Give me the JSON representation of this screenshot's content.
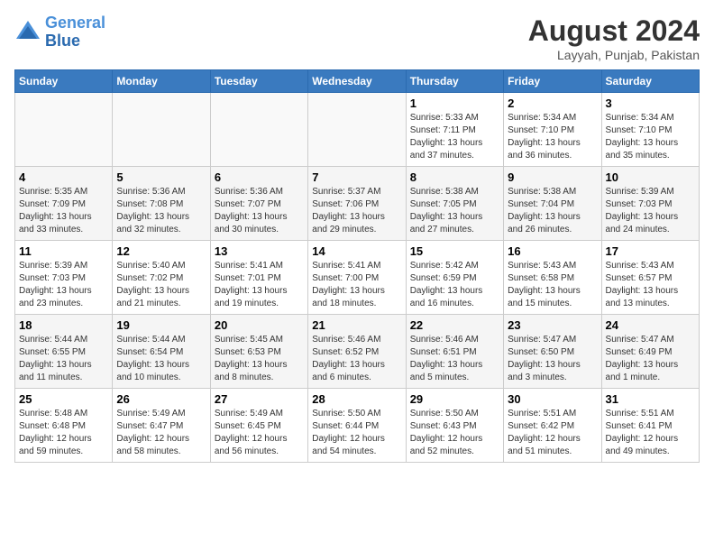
{
  "header": {
    "logo_line1": "General",
    "logo_line2": "Blue",
    "month_year": "August 2024",
    "location": "Layyah, Punjab, Pakistan"
  },
  "weekdays": [
    "Sunday",
    "Monday",
    "Tuesday",
    "Wednesday",
    "Thursday",
    "Friday",
    "Saturday"
  ],
  "weeks": [
    [
      {
        "day": "",
        "info": ""
      },
      {
        "day": "",
        "info": ""
      },
      {
        "day": "",
        "info": ""
      },
      {
        "day": "",
        "info": ""
      },
      {
        "day": "1",
        "info": "Sunrise: 5:33 AM\nSunset: 7:11 PM\nDaylight: 13 hours\nand 37 minutes."
      },
      {
        "day": "2",
        "info": "Sunrise: 5:34 AM\nSunset: 7:10 PM\nDaylight: 13 hours\nand 36 minutes."
      },
      {
        "day": "3",
        "info": "Sunrise: 5:34 AM\nSunset: 7:10 PM\nDaylight: 13 hours\nand 35 minutes."
      }
    ],
    [
      {
        "day": "4",
        "info": "Sunrise: 5:35 AM\nSunset: 7:09 PM\nDaylight: 13 hours\nand 33 minutes."
      },
      {
        "day": "5",
        "info": "Sunrise: 5:36 AM\nSunset: 7:08 PM\nDaylight: 13 hours\nand 32 minutes."
      },
      {
        "day": "6",
        "info": "Sunrise: 5:36 AM\nSunset: 7:07 PM\nDaylight: 13 hours\nand 30 minutes."
      },
      {
        "day": "7",
        "info": "Sunrise: 5:37 AM\nSunset: 7:06 PM\nDaylight: 13 hours\nand 29 minutes."
      },
      {
        "day": "8",
        "info": "Sunrise: 5:38 AM\nSunset: 7:05 PM\nDaylight: 13 hours\nand 27 minutes."
      },
      {
        "day": "9",
        "info": "Sunrise: 5:38 AM\nSunset: 7:04 PM\nDaylight: 13 hours\nand 26 minutes."
      },
      {
        "day": "10",
        "info": "Sunrise: 5:39 AM\nSunset: 7:03 PM\nDaylight: 13 hours\nand 24 minutes."
      }
    ],
    [
      {
        "day": "11",
        "info": "Sunrise: 5:39 AM\nSunset: 7:03 PM\nDaylight: 13 hours\nand 23 minutes."
      },
      {
        "day": "12",
        "info": "Sunrise: 5:40 AM\nSunset: 7:02 PM\nDaylight: 13 hours\nand 21 minutes."
      },
      {
        "day": "13",
        "info": "Sunrise: 5:41 AM\nSunset: 7:01 PM\nDaylight: 13 hours\nand 19 minutes."
      },
      {
        "day": "14",
        "info": "Sunrise: 5:41 AM\nSunset: 7:00 PM\nDaylight: 13 hours\nand 18 minutes."
      },
      {
        "day": "15",
        "info": "Sunrise: 5:42 AM\nSunset: 6:59 PM\nDaylight: 13 hours\nand 16 minutes."
      },
      {
        "day": "16",
        "info": "Sunrise: 5:43 AM\nSunset: 6:58 PM\nDaylight: 13 hours\nand 15 minutes."
      },
      {
        "day": "17",
        "info": "Sunrise: 5:43 AM\nSunset: 6:57 PM\nDaylight: 13 hours\nand 13 minutes."
      }
    ],
    [
      {
        "day": "18",
        "info": "Sunrise: 5:44 AM\nSunset: 6:55 PM\nDaylight: 13 hours\nand 11 minutes."
      },
      {
        "day": "19",
        "info": "Sunrise: 5:44 AM\nSunset: 6:54 PM\nDaylight: 13 hours\nand 10 minutes."
      },
      {
        "day": "20",
        "info": "Sunrise: 5:45 AM\nSunset: 6:53 PM\nDaylight: 13 hours\nand 8 minutes."
      },
      {
        "day": "21",
        "info": "Sunrise: 5:46 AM\nSunset: 6:52 PM\nDaylight: 13 hours\nand 6 minutes."
      },
      {
        "day": "22",
        "info": "Sunrise: 5:46 AM\nSunset: 6:51 PM\nDaylight: 13 hours\nand 5 minutes."
      },
      {
        "day": "23",
        "info": "Sunrise: 5:47 AM\nSunset: 6:50 PM\nDaylight: 13 hours\nand 3 minutes."
      },
      {
        "day": "24",
        "info": "Sunrise: 5:47 AM\nSunset: 6:49 PM\nDaylight: 13 hours\nand 1 minute."
      }
    ],
    [
      {
        "day": "25",
        "info": "Sunrise: 5:48 AM\nSunset: 6:48 PM\nDaylight: 12 hours\nand 59 minutes."
      },
      {
        "day": "26",
        "info": "Sunrise: 5:49 AM\nSunset: 6:47 PM\nDaylight: 12 hours\nand 58 minutes."
      },
      {
        "day": "27",
        "info": "Sunrise: 5:49 AM\nSunset: 6:45 PM\nDaylight: 12 hours\nand 56 minutes."
      },
      {
        "day": "28",
        "info": "Sunrise: 5:50 AM\nSunset: 6:44 PM\nDaylight: 12 hours\nand 54 minutes."
      },
      {
        "day": "29",
        "info": "Sunrise: 5:50 AM\nSunset: 6:43 PM\nDaylight: 12 hours\nand 52 minutes."
      },
      {
        "day": "30",
        "info": "Sunrise: 5:51 AM\nSunset: 6:42 PM\nDaylight: 12 hours\nand 51 minutes."
      },
      {
        "day": "31",
        "info": "Sunrise: 5:51 AM\nSunset: 6:41 PM\nDaylight: 12 hours\nand 49 minutes."
      }
    ]
  ]
}
